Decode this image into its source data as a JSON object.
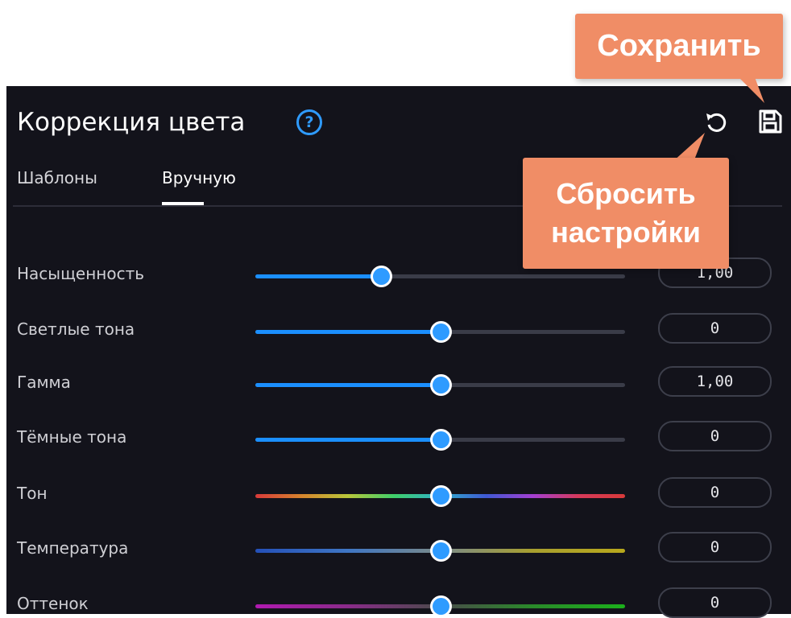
{
  "panel": {
    "title": "Коррекция цвета",
    "help_symbol": "?",
    "reset_icon": "reset-icon",
    "save_icon": "floppy-disk-icon"
  },
  "tabs": [
    {
      "label": "Шаблоны",
      "active": false
    },
    {
      "label": "Вручную",
      "active": true
    }
  ],
  "sliders": [
    {
      "label": "Насыщенность",
      "value": "1,00",
      "position": 0.34,
      "type": "plain"
    },
    {
      "label": "Светлые тона",
      "value": "0",
      "position": 0.5,
      "type": "plain"
    },
    {
      "label": "Гамма",
      "value": "1,00",
      "position": 0.5,
      "type": "plain"
    },
    {
      "label": "Тёмные тона",
      "value": "0",
      "position": 0.5,
      "type": "plain"
    },
    {
      "label": "Тон",
      "value": "0",
      "position": 0.5,
      "type": "hue"
    },
    {
      "label": "Температура",
      "value": "0",
      "position": 0.5,
      "type": "temperature"
    },
    {
      "label": "Оттенок",
      "value": "0",
      "position": 0.5,
      "type": "tint"
    }
  ],
  "callouts": {
    "save": "Сохранить",
    "reset": "Сбросить настройки"
  },
  "colors": {
    "panel_bg": "#13131b",
    "accent": "#1b8fff",
    "callout": "#f08d66"
  }
}
